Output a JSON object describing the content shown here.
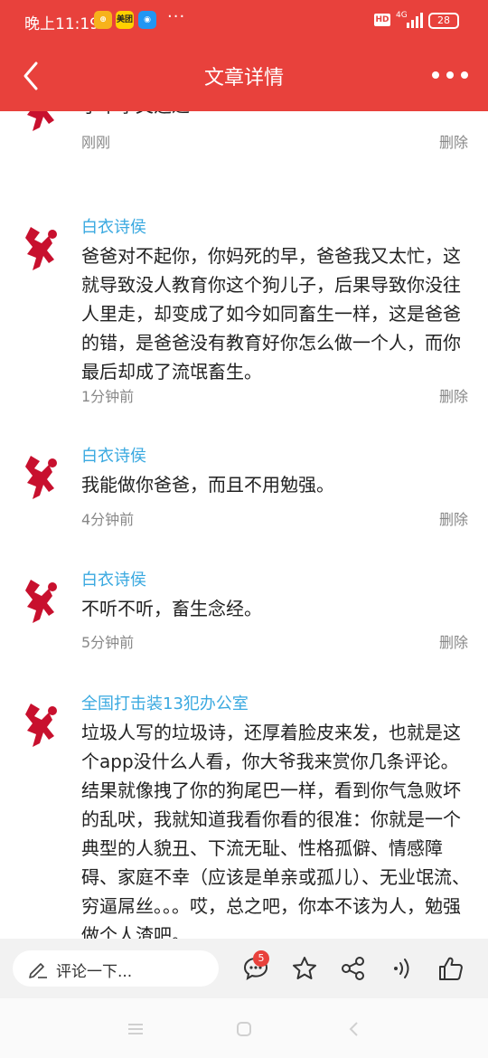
{
  "status_bar": {
    "time": "晚上11:19",
    "badge1": "⊕",
    "badge2": "美团",
    "badge3": "◉",
    "dots": "···",
    "hd": "HD",
    "network": "4G",
    "battery": "28"
  },
  "nav": {
    "title": "文章详情"
  },
  "comments": [
    {
      "author": "",
      "content": "子不孝父之过",
      "time": "刚刚",
      "delete_label": "删除"
    },
    {
      "author": "白衣诗侯",
      "content": "爸爸对不起你，你妈死的早，爸爸我又太忙，这就导致没人教育你这个狗儿子，后果导致你没往人里走，却变成了如今如同畜生一样，这是爸爸的错，是爸爸没有教育好你怎么做一个人，而你最后却成了流氓畜生。",
      "time": "1分钟前",
      "delete_label": "删除"
    },
    {
      "author": "白衣诗侯",
      "content": "我能做你爸爸，而且不用勉强。",
      "time": "4分钟前",
      "delete_label": "删除"
    },
    {
      "author": "白衣诗侯",
      "content": "不听不听，畜生念经。",
      "time": "5分钟前",
      "delete_label": "删除"
    },
    {
      "author": "全国打击装13犯办公室",
      "content": "垃圾人写的垃圾诗，还厚着脸皮来发，也就是这个app没什么人看，你大爷我来赏你几条评论。结果就像拽了你的狗尾巴一样，看到你气急败坏的乱吠，我就知道我看你看的很准：你就是一个典型的人貌丑、下流无耻、性格孤僻、情感障碍、家庭不幸（应该是单亲或孤儿）、无业氓流、穷逼屌丝。。。哎，总之吧，你本不该为人，勉强做个人渣吧。",
      "time": "",
      "delete_label": ""
    }
  ],
  "bottom_bar": {
    "placeholder": "评论一下...",
    "comment_count": "5"
  },
  "colors": {
    "brand": "#e8413c",
    "author": "#3aa9e0"
  }
}
